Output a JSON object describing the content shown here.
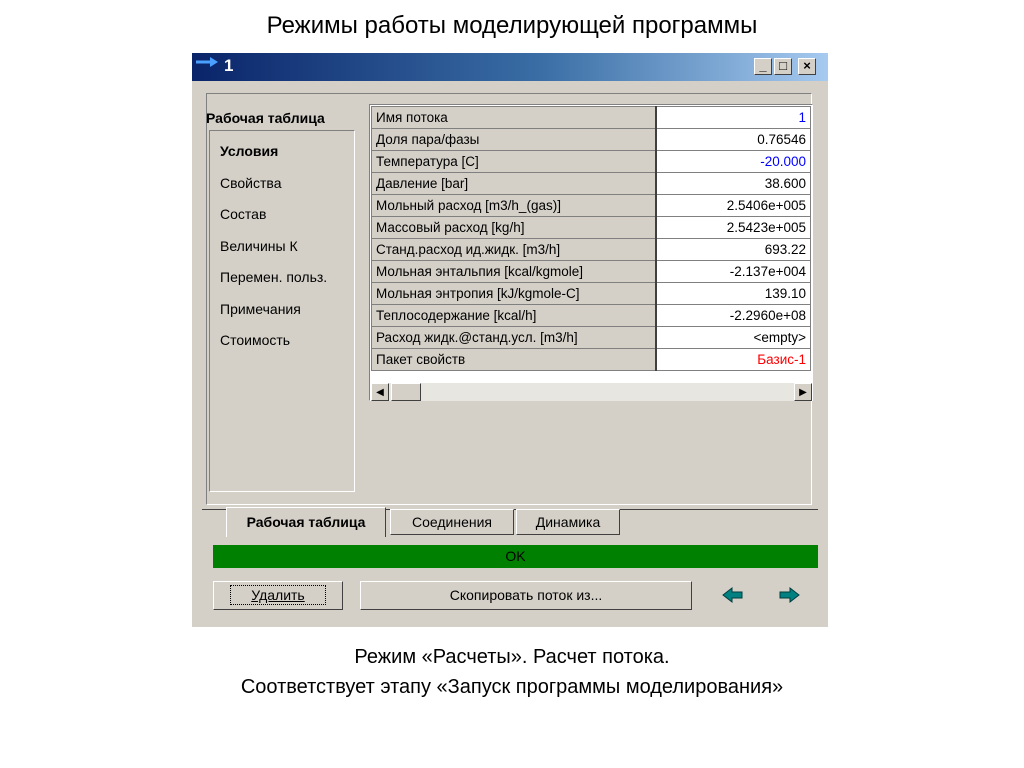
{
  "slide": {
    "title": "Режимы работы моделирующей программы",
    "caption_line1": "Режим «Расчеты». Расчет потока.",
    "caption_line2": "Соответствует этапу «Запуск программы моделирования»"
  },
  "window": {
    "title": "1",
    "minimize": "_",
    "maximize": "□",
    "close": "×"
  },
  "nav": {
    "heading": "Рабочая таблица",
    "items": [
      "Условия",
      "Свойства",
      "Состав",
      "Величины К",
      "Перемен. польз.",
      "Примечания",
      "Стоимость"
    ],
    "selected": "Условия"
  },
  "grid": {
    "rows": [
      {
        "label": "Имя потока",
        "value": "1",
        "color": "#0000ff"
      },
      {
        "label": "Доля пара/фазы",
        "value": "0.76546",
        "color": "#000000"
      },
      {
        "label": "Температура [C]",
        "value": "-20.000",
        "color": "#0000ff"
      },
      {
        "label": "Давление [bar]",
        "value": "38.600",
        "color": "#000000"
      },
      {
        "label": "Мольный расход [m3/h_(gas)]",
        "value": "2.5406e+005",
        "color": "#000000"
      },
      {
        "label": "Массовый расход [kg/h]",
        "value": "2.5423e+005",
        "color": "#000000"
      },
      {
        "label": "Станд.расход ид.жидк. [m3/h]",
        "value": "693.22",
        "color": "#000000"
      },
      {
        "label": "Мольная энтальпия [kcal/kgmole]",
        "value": "-2.137e+004",
        "color": "#000000"
      },
      {
        "label": "Мольная энтропия [kJ/kgmole-C]",
        "value": "139.10",
        "color": "#000000"
      },
      {
        "label": "Теплосодержание [kcal/h]",
        "value": "-2.2960e+08",
        "color": "#000000"
      },
      {
        "label": "Расход жидк.@станд.усл. [m3/h]",
        "value": "<empty>",
        "color": "#000000"
      },
      {
        "label": "Пакет свойств",
        "value": "Базис-1",
        "color": "#ff0000"
      }
    ]
  },
  "tabs": [
    "Рабочая таблица",
    "Соединения",
    "Динамика"
  ],
  "active_tab": "Рабочая таблица",
  "status": {
    "text": "OK",
    "color": "#008000"
  },
  "buttons": {
    "delete": "Удалить",
    "copy_stream": "Скопировать поток из..."
  },
  "colors": {
    "arrow": "#008080",
    "titlebar": "#0a246a"
  }
}
